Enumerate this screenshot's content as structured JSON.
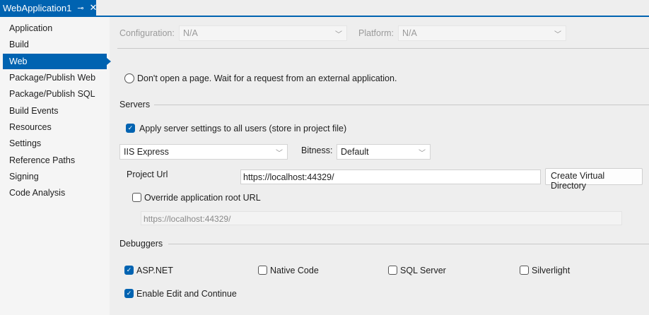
{
  "tab": {
    "title": "WebApplication1",
    "pin_icon": "pin-icon",
    "close_icon": "close-icon"
  },
  "sidebar": {
    "items": [
      {
        "label": "Application"
      },
      {
        "label": "Build"
      },
      {
        "label": "Web",
        "selected": true
      },
      {
        "label": "Package/Publish Web"
      },
      {
        "label": "Package/Publish SQL"
      },
      {
        "label": "Build Events"
      },
      {
        "label": "Resources"
      },
      {
        "label": "Settings"
      },
      {
        "label": "Reference Paths"
      },
      {
        "label": "Signing"
      },
      {
        "label": "Code Analysis"
      }
    ]
  },
  "config": {
    "configuration_label": "Configuration:",
    "configuration_value": "N/A",
    "platform_label": "Platform:",
    "platform_value": "N/A"
  },
  "start_action": {
    "dont_open_label": "Don't open a page.  Wait for a request from an external application."
  },
  "servers": {
    "heading": "Servers",
    "apply_all_label": "Apply server settings to all users (store in project file)",
    "server_value": "IIS Express",
    "bitness_label": "Bitness:",
    "bitness_value": "Default",
    "project_url_label": "Project Url",
    "project_url_value": "https://localhost:44329/",
    "create_vdir_label": "Create Virtual Directory",
    "override_label": "Override application root URL",
    "override_value": "https://localhost:44329/"
  },
  "debuggers": {
    "heading": "Debuggers",
    "aspnet": "ASP.NET",
    "native": "Native Code",
    "sql": "SQL Server",
    "silverlight": "Silverlight",
    "edit_continue": "Enable Edit and Continue"
  }
}
